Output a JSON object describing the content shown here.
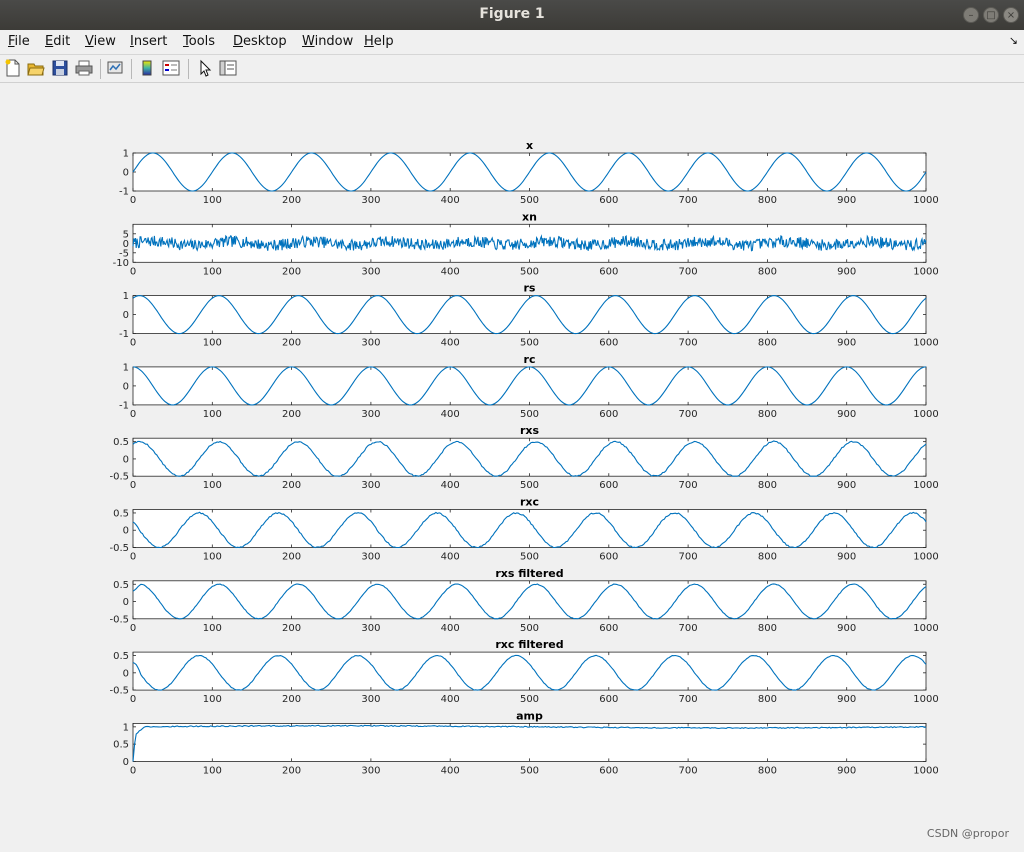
{
  "window": {
    "title": "Figure 1"
  },
  "menu": [
    "File",
    "Edit",
    "View",
    "Insert",
    "Tools",
    "Desktop",
    "Window",
    "Help"
  ],
  "menu_access_keys": [
    "F",
    "E",
    "V",
    "I",
    "T",
    "D",
    "W",
    "H"
  ],
  "toolbar": [
    "new-figure-icon",
    "open-file-icon",
    "save-icon",
    "print-icon",
    "link-plot-icon",
    "colorbar-icon",
    "legend-icon",
    "edit-plot-cursor-icon",
    "property-inspector-icon"
  ],
  "watermark": "CSDN @propor",
  "colors": {
    "line": "#0072bd",
    "axes_bg": "#ffffff",
    "figure_bg": "#f0f0f0"
  },
  "chart_data": [
    {
      "type": "line",
      "title": "x",
      "xlim": [
        0,
        1000
      ],
      "ylim": [
        -1,
        1
      ],
      "xticks": [
        0,
        100,
        200,
        300,
        400,
        500,
        600,
        700,
        800,
        900,
        1000
      ],
      "yticks": [
        1,
        0,
        -1
      ],
      "series": [
        {
          "shape": "sine",
          "amplitude": 1,
          "period": 100,
          "phase_deg": 0,
          "noise": 0,
          "seed": 11
        }
      ]
    },
    {
      "type": "line",
      "title": "xn",
      "xlim": [
        0,
        1000
      ],
      "ylim": [
        -10,
        10
      ],
      "xticks": [
        0,
        100,
        200,
        300,
        400,
        500,
        600,
        700,
        800,
        900,
        1000
      ],
      "yticks": [
        5,
        0,
        -5,
        -10
      ],
      "series": [
        {
          "shape": "sine",
          "amplitude": 1,
          "period": 100,
          "phase_deg": 0,
          "noise": 3,
          "seed": 7
        }
      ]
    },
    {
      "type": "line",
      "title": "rs",
      "xlim": [
        0,
        1000
      ],
      "ylim": [
        -1,
        1
      ],
      "xticks": [
        0,
        100,
        200,
        300,
        400,
        500,
        600,
        700,
        800,
        900,
        1000
      ],
      "yticks": [
        1,
        0,
        -1
      ],
      "series": [
        {
          "shape": "sine",
          "amplitude": 1,
          "period": 100,
          "phase_deg": 60,
          "noise": 0,
          "seed": 3
        }
      ]
    },
    {
      "type": "line",
      "title": "rc",
      "xlim": [
        0,
        1000
      ],
      "ylim": [
        -1,
        1
      ],
      "xticks": [
        0,
        100,
        200,
        300,
        400,
        500,
        600,
        700,
        800,
        900,
        1000
      ],
      "yticks": [
        1,
        0,
        -1
      ],
      "series": [
        {
          "shape": "sine",
          "amplitude": 1,
          "period": 100,
          "phase_deg": 90,
          "noise": 0,
          "seed": 4
        }
      ]
    },
    {
      "type": "line",
      "title": "rxs",
      "xlim": [
        0,
        1000
      ],
      "ylim": [
        -0.5,
        0.6
      ],
      "xticks": [
        0,
        100,
        200,
        300,
        400,
        500,
        600,
        700,
        800,
        900,
        1000
      ],
      "yticks": [
        0.5,
        0,
        -0.5
      ],
      "series": [
        {
          "shape": "sine",
          "amplitude": 0.5,
          "period": 100,
          "phase_deg": 60,
          "noise": 0.02,
          "seed": 5
        }
      ]
    },
    {
      "type": "line",
      "title": "rxc",
      "xlim": [
        0,
        1000
      ],
      "ylim": [
        -0.5,
        0.6
      ],
      "xticks": [
        0,
        100,
        200,
        300,
        400,
        500,
        600,
        700,
        800,
        900,
        1000
      ],
      "yticks": [
        0.5,
        0,
        -0.5
      ],
      "series": [
        {
          "shape": "sine",
          "amplitude": 0.5,
          "period": 100,
          "phase_deg": 150,
          "noise": 0.02,
          "seed": 6
        }
      ]
    },
    {
      "type": "line",
      "title": "rxs filtered",
      "xlim": [
        0,
        1000
      ],
      "ylim": [
        -0.5,
        0.6
      ],
      "xticks": [
        0,
        100,
        200,
        300,
        400,
        500,
        600,
        700,
        800,
        900,
        1000
      ],
      "yticks": [
        0.5,
        0,
        -0.5
      ],
      "series": [
        {
          "shape": "sine",
          "amplitude": 0.5,
          "period": 100,
          "phase_deg": 60,
          "noise": 0.01,
          "seed": 8,
          "transient": true
        }
      ]
    },
    {
      "type": "line",
      "title": "rxc filtered",
      "xlim": [
        0,
        1000
      ],
      "ylim": [
        -0.5,
        0.6
      ],
      "xticks": [
        0,
        100,
        200,
        300,
        400,
        500,
        600,
        700,
        800,
        900,
        1000
      ],
      "yticks": [
        0.5,
        0,
        -0.5
      ],
      "series": [
        {
          "shape": "sine",
          "amplitude": 0.5,
          "period": 100,
          "phase_deg": 150,
          "noise": 0.01,
          "seed": 9,
          "transient": true
        }
      ]
    },
    {
      "type": "line",
      "title": "amp",
      "xlim": [
        0,
        1000
      ],
      "ylim": [
        0,
        1.1
      ],
      "xticks": [
        0,
        100,
        200,
        300,
        400,
        500,
        600,
        700,
        800,
        900,
        1000
      ],
      "yticks": [
        1,
        0.5,
        0
      ],
      "series": [
        {
          "shape": "amp",
          "level": 1.0,
          "noise": 0.015,
          "seed": 10
        }
      ]
    }
  ]
}
